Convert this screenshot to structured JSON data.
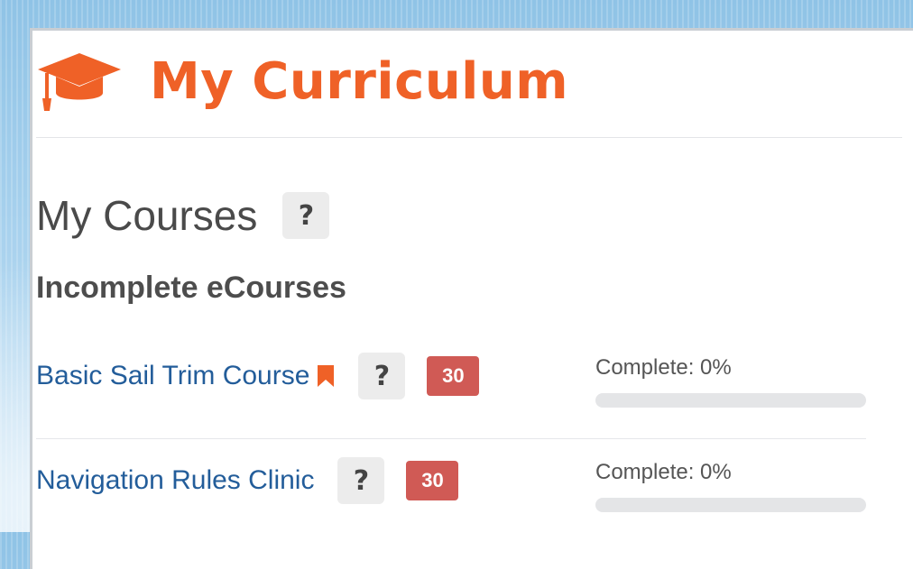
{
  "header": {
    "icon": "graduation-cap-icon",
    "title": "My Curriculum"
  },
  "courses_section": {
    "title": "My Courses",
    "help_label": "?"
  },
  "incomplete": {
    "title": "Incomplete eCourses",
    "courses": [
      {
        "name": "Basic Sail Trim Course",
        "bookmarked": true,
        "help_label": "?",
        "badge": "30",
        "progress_label": "Complete: 0%",
        "progress": 0
      },
      {
        "name": "Navigation Rules Clinic",
        "bookmarked": false,
        "help_label": "?",
        "badge": "30",
        "progress_label": "Complete: 0%",
        "progress": 0
      }
    ]
  },
  "colors": {
    "accent": "#ef6127",
    "link": "#235d9a",
    "badge": "#d05a55",
    "track": "#e4e5e7"
  }
}
